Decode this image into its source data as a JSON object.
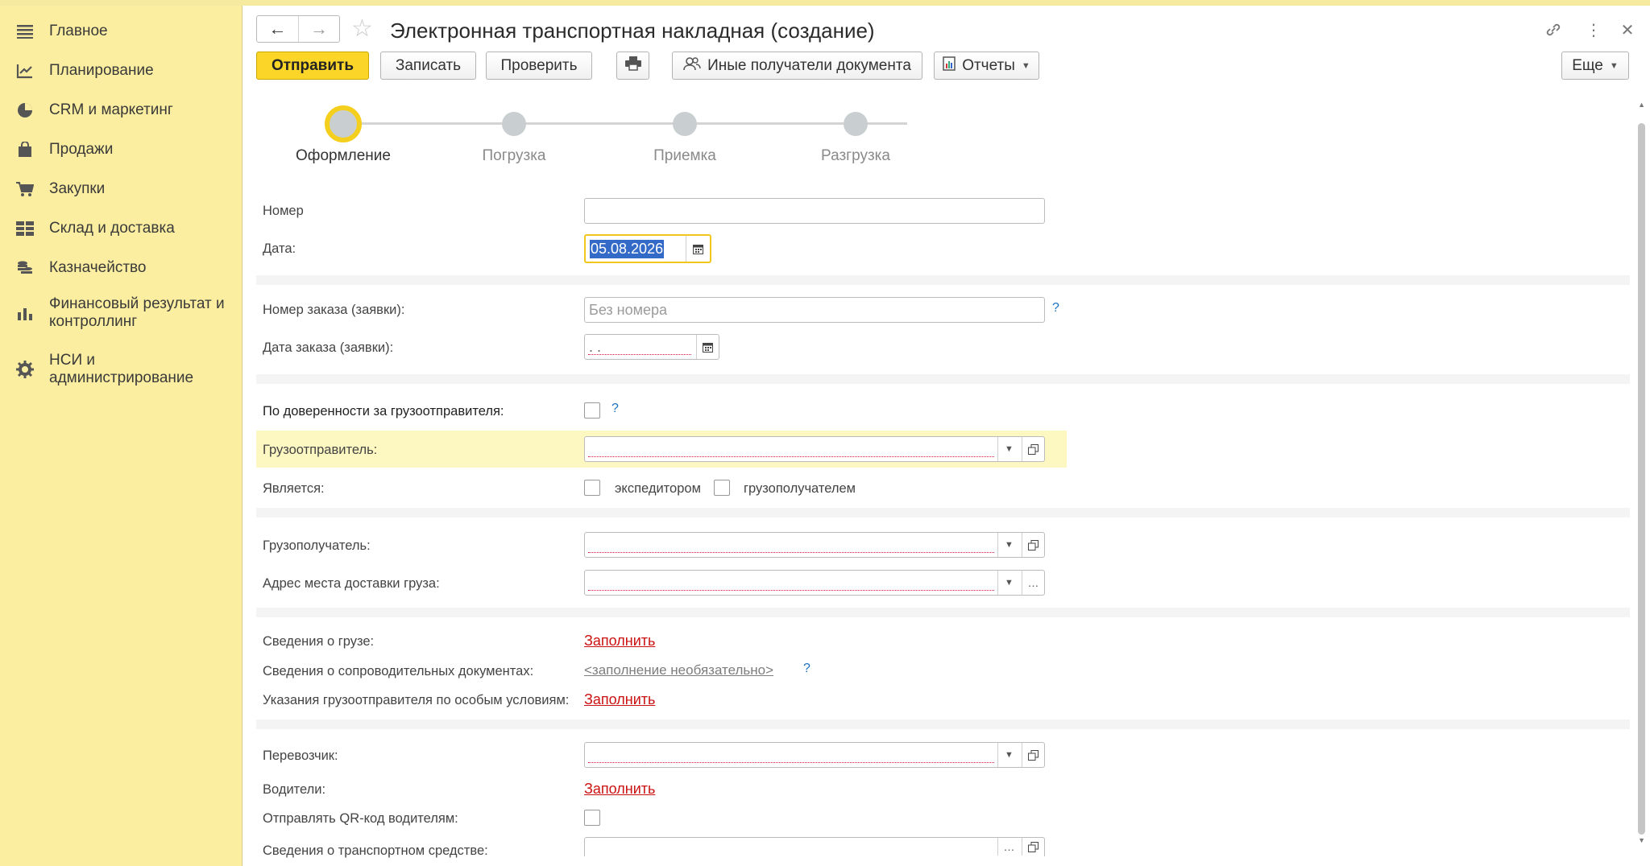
{
  "sidebar": {
    "items": [
      {
        "label": "Главное",
        "icon": "menu-icon"
      },
      {
        "label": "Планирование",
        "icon": "planning-icon"
      },
      {
        "label": "CRM и маркетинг",
        "icon": "crm-pie-icon"
      },
      {
        "label": "Продажи",
        "icon": "shopping-bag-icon"
      },
      {
        "label": "Закупки",
        "icon": "cart-icon"
      },
      {
        "label": "Склад и доставка",
        "icon": "warehouse-icon"
      },
      {
        "label": "Казначейство",
        "icon": "coins-icon"
      },
      {
        "label": "Финансовый результат и контроллинг",
        "icon": "bar-chart-icon"
      },
      {
        "label": "НСИ и администрирование",
        "icon": "gear-icon"
      }
    ]
  },
  "header": {
    "title": "Электронная транспортная накладная (создание)"
  },
  "toolbar": {
    "send": "Отправить",
    "save": "Записать",
    "check": "Проверить",
    "other_recipients": "Иные получатели документа",
    "reports": "Отчеты",
    "more": "Еще"
  },
  "stepper": {
    "steps": [
      "Оформление",
      "Погрузка",
      "Приемка",
      "Разгрузка"
    ],
    "active_index": 0
  },
  "form": {
    "number_label": "Номер",
    "number_value": "",
    "date_label": "Дата:",
    "date_value": "05.08.2026",
    "order_number_label": "Номер заказа (заявки):",
    "order_number_placeholder": "Без номера",
    "order_date_label": "Дата заказа (заявки):",
    "order_date_value": " .  .",
    "proxy_label": "По доверенности за грузоотправителя:",
    "shipper_label": "Грузоотправитель:",
    "is_label": "Является:",
    "forwarder_label": "экспедитором",
    "consignee_self_label": "грузополучателем",
    "consignee_label": "Грузополучатель:",
    "delivery_address_label": "Адрес места доставки груза:",
    "cargo_info_label": "Сведения о грузе:",
    "fill_link": "Заполнить",
    "accompanying_docs_label": "Сведения о сопроводительных документах:",
    "optional_link": "<заполнение необязательно>",
    "special_conditions_label": "Указания грузоотправителя по особым условиям:",
    "carrier_label": "Перевозчик:",
    "drivers_label": "Водители:",
    "send_qr_label": "Отправлять QR-код водителям:",
    "vehicle_label": "Сведения о транспортном средстве:",
    "help_mark": "?"
  },
  "colors": {
    "sidebar_bg": "#fbeea0",
    "primary_button": "#fbd628",
    "active_step_ring": "#f5cf1e",
    "link_red": "#cc1111",
    "help_blue": "#1a72c2",
    "highlight_row": "#fdf7c1"
  }
}
